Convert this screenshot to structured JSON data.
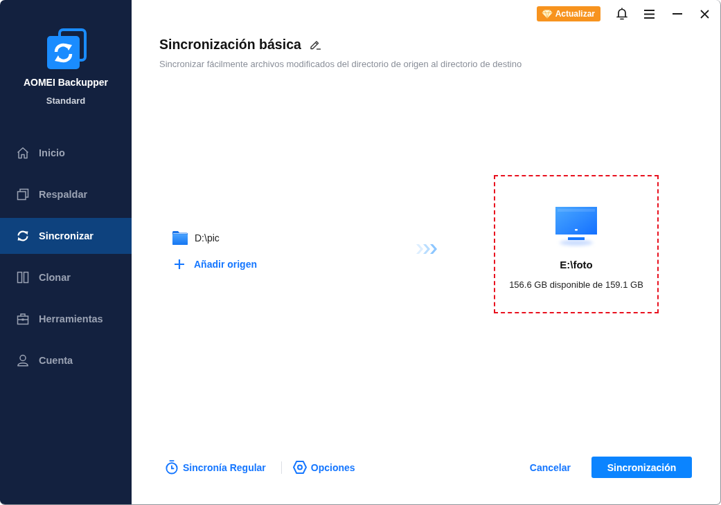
{
  "sidebar": {
    "app_name": "AOMEI Backupper",
    "edition": "Standard",
    "items": [
      {
        "label": "Inicio",
        "selected": false
      },
      {
        "label": "Respaldar",
        "selected": false
      },
      {
        "label": "Sincronizar",
        "selected": true
      },
      {
        "label": "Clonar",
        "selected": false
      },
      {
        "label": "Herramientas",
        "selected": false
      },
      {
        "label": "Cuenta",
        "selected": false
      }
    ]
  },
  "toolbar": {
    "upgrade_button": "Actualizar"
  },
  "header": {
    "title": "Sincronización básica",
    "subtitle": "Sincronizar fácilmente archivos modificados del directorio de origen al directorio de destino"
  },
  "source": {
    "folders": [
      {
        "path": "D:\\pic"
      }
    ],
    "add_button": "Añadir origen"
  },
  "destination": {
    "path": "E:\\foto",
    "capacity": "156.6 GB disponible de 159.1 GB",
    "highlighted": true
  },
  "footer": {
    "links": [
      "Sincronía Regular",
      "Opciones"
    ],
    "cancel_button": "Cancelar",
    "confirm_button": "Sincronización"
  }
}
